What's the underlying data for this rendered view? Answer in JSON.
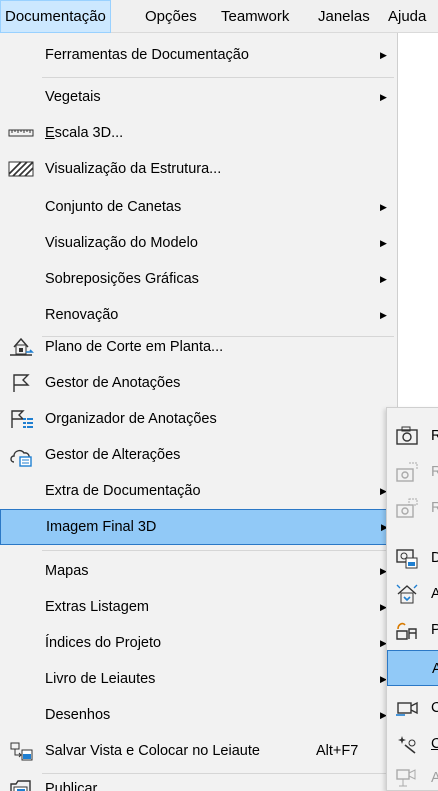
{
  "menubar": {
    "items": [
      {
        "label": "Documentação",
        "active": true
      },
      {
        "label": "Opções"
      },
      {
        "label": "Teamwork"
      },
      {
        "label": "Janelas"
      },
      {
        "label": "Ajuda"
      }
    ]
  },
  "menu": {
    "items": [
      {
        "label": "Ferramentas de Documentação",
        "submenu": true,
        "icon": null
      },
      {
        "label": "Vegetais",
        "submenu": true,
        "icon": null
      },
      {
        "label_prefix": "",
        "mnemonic": "E",
        "label_rest": "scala 3D...",
        "icon": "ruler-icon"
      },
      {
        "label": "Visualização da Estrutura...",
        "icon": "hatch-pattern-icon"
      },
      {
        "label": "Conjunto de Canetas",
        "submenu": true
      },
      {
        "label": "Visualização do Modelo",
        "submenu": true
      },
      {
        "label": "Sobreposições Gráficas",
        "submenu": true
      },
      {
        "label": "Renovação",
        "submenu": true
      },
      {
        "label": "Plano de Corte em Planta...",
        "icon": "cut-plane-icon"
      },
      {
        "label": "Gestor de Anotações",
        "icon": "flag-icon"
      },
      {
        "label": "Organizador de Anotações",
        "icon": "flag-list-icon"
      },
      {
        "label": "Gestor de Alterações",
        "icon": "cloud-change-icon"
      },
      {
        "label": "Extra de Documentação",
        "submenu": true
      },
      {
        "label": "Imagem Final 3D",
        "submenu": true,
        "selected": true
      },
      {
        "label": "Mapas",
        "submenu": true
      },
      {
        "label": "Extras Listagem",
        "submenu": true
      },
      {
        "label": "Índices do Projeto",
        "submenu": true
      },
      {
        "label": "Livro de Leiautes",
        "submenu": true
      },
      {
        "label": "Desenhos",
        "submenu": true
      },
      {
        "label": "Salvar Vista e Colocar no Leiaute",
        "shortcut": "Alt+F7",
        "icon": "save-view-icon"
      },
      {
        "label_prefix": "",
        "mnemonic": "P",
        "label_rest": "ublicar...",
        "icon": "publish-icon"
      }
    ]
  },
  "submenu": {
    "items": [
      {
        "letter": "R",
        "icon": "camera-icon",
        "disabled": false
      },
      {
        "letter": "R",
        "icon": "camera-region-icon",
        "disabled": true
      },
      {
        "letter": "R",
        "icon": "camera-frame-icon",
        "disabled": true
      },
      {
        "letter": "D",
        "icon": "render-settings-icon",
        "disabled": false
      },
      {
        "letter": "A",
        "icon": "house-light-icon",
        "disabled": false
      },
      {
        "letter": "P",
        "icon": "paint-icon",
        "disabled": false
      },
      {
        "letter": "A",
        "icon": null,
        "disabled": false,
        "selected": true
      },
      {
        "letter": "C",
        "icon": "video-camera-icon",
        "disabled": false
      },
      {
        "letter": "C",
        "icon": "magic-icon",
        "disabled": false,
        "underline": true
      },
      {
        "letter": "A",
        "icon": "render-disabled-icon",
        "disabled": true
      }
    ]
  },
  "colors": {
    "menu_bg": "#f2f2f2",
    "highlight": "#91c9f7",
    "highlight_border": "#2b78c6",
    "menubar_active": "#cce8ff"
  }
}
